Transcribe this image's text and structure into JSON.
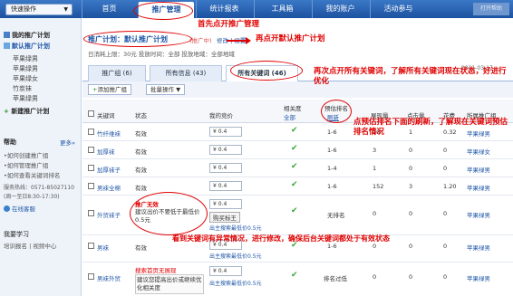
{
  "nav": {
    "quick_action": "快速操作",
    "tabs": [
      "首页",
      "推广管理",
      "统计报表",
      "工具箱",
      "我的账户",
      "活动参与"
    ],
    "logo": "打开帮助"
  },
  "sidebar": {
    "my_plans": "我的推广计划",
    "default_plan": "默认推广计划",
    "groups": [
      "苹果绿男",
      "苹果绿男",
      "苹果绿女",
      "竹炭袜",
      "苹果绿男"
    ],
    "new_plan": "新建推广计划",
    "help_title": "帮助",
    "more": "更多»",
    "help_links": [
      "•如何创建推广组",
      "•如何管理推广组",
      "•如何查看关键词排名"
    ],
    "service": "服务热线：0571-85027110",
    "service_hours": "(周一至日8:30-17:30)",
    "online_service": "在线客服",
    "learn_title": "我要学习",
    "learn_links": "培训报名 | 视频中心"
  },
  "main": {
    "plan_label": "推广计划：默认推广计划",
    "plan_status": "(推广中)",
    "plan_links": "修改 | 设置",
    "budget_line": "日消耗上限：30元  投放时间：全部  投放地域：全部地域",
    "date_hint": "2011-03-17",
    "tabs": [
      "推广组 (6)",
      "所有信息 (43)",
      "所有关键词 (46)"
    ],
    "toolbar": {
      "add": "添加推广组",
      "bulk": "批量操作"
    },
    "columns": [
      "关键词",
      "状态",
      "我的竞价",
      "相关度",
      "预估排名",
      "展现量",
      "点击量",
      "花费",
      "所属推广组"
    ],
    "col_sub": [
      "全部",
      "刷新"
    ],
    "rows": [
      {
        "kw": "竹纤维袜",
        "status": "有效",
        "bid": "0.4",
        "rank": "1-6",
        "imp": "10",
        "clk": "1",
        "cost": "0.32",
        "group": "苹果绿男"
      },
      {
        "kw": "加厚袜",
        "status": "有效",
        "bid": "0.4",
        "rank": "1-6",
        "imp": "3",
        "clk": "0",
        "cost": "0",
        "group": "苹果绿女"
      },
      {
        "kw": "加厚袜子",
        "status": "有效",
        "bid": "0.4",
        "rank": "1-4",
        "imp": "1",
        "clk": "0",
        "cost": "0",
        "group": "苹果绿男"
      },
      {
        "kw": "男袜全棉",
        "status": "有效",
        "bid": "0.4",
        "rank": "1-6",
        "imp": "152",
        "clk": "3",
        "cost": "1.20",
        "group": "苹果绿男"
      },
      {
        "kw": "外贸袜子",
        "status": "推广无效",
        "note": "建议出价不要低于最低价0.5元",
        "bid": "0.4",
        "bid_hint": "出主搜索最低价0.5元",
        "rank": "无排名",
        "imp": "0",
        "clk": "0",
        "cost": "0",
        "group": "苹果绿男",
        "fix": "购买标王"
      },
      {
        "kw": "男袜",
        "status": "有效",
        "bid": "0.4",
        "bid_hint": "出主搜索最低价0.5元",
        "rank": "1-6",
        "imp": "0",
        "clk": "0",
        "cost": "0",
        "group": "苹果绿男"
      },
      {
        "kw": "男袜外贸",
        "status": "搜索首页无展现",
        "note": "建议您提高出价或继续优化相关度",
        "bid": "0.4",
        "bid_hint": "出主搜索最低价0.5元",
        "rank": "排名过低",
        "imp": "0",
        "clk": "0",
        "cost": "0",
        "group": "苹果绿男"
      }
    ]
  },
  "annotations": {
    "a1": "首先点开推广管理",
    "a2": "再点开默认推广计划",
    "a3": "再次点开所有关键词，了解所有关键词现在状态，好进行优化",
    "a4": "点预估排名下面的刷新，了解现在关键词预估排名情况",
    "a5": "看到关键词有异常情况，进行修改，确保后台关键词都处于有效状态"
  }
}
